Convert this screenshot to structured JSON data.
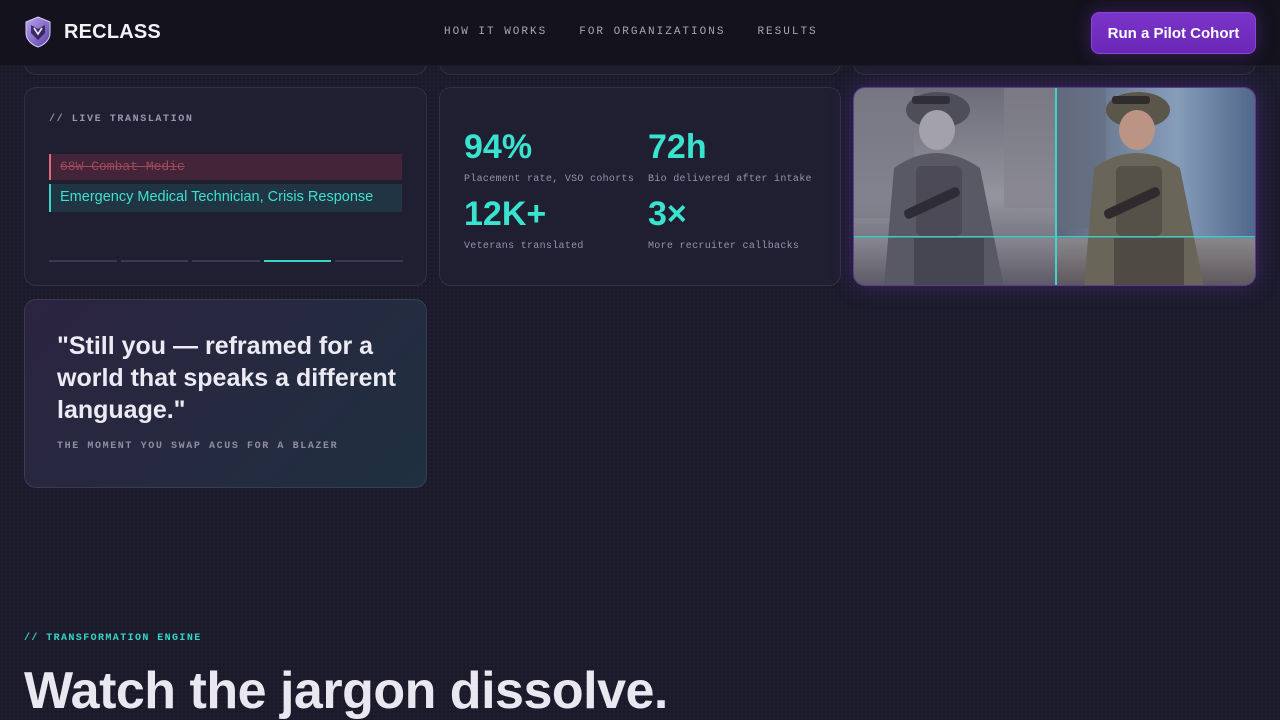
{
  "header": {
    "brand": "RECLASS",
    "nav": [
      "HOW IT WORKS",
      "FOR ORGANIZATIONS",
      "RESULTS"
    ],
    "cta": "Run a Pilot Cohort"
  },
  "live_translation": {
    "label": "// LIVE TRANSLATION",
    "original": "68W Combat Medic",
    "translated": "Emergency Medical Technician, Crisis Response",
    "progress": {
      "steps": 5,
      "active_step": 4
    }
  },
  "stats": [
    {
      "value": "94%",
      "label": "Placement rate, VSO cohorts"
    },
    {
      "value": "72h",
      "label": "Bio delivered after intake"
    },
    {
      "value": "12K+",
      "label": "Veterans translated"
    },
    {
      "value": "3×",
      "label": "More recruiter callbacks"
    }
  ],
  "quote": {
    "text": "\"Still you — reframed for a world that speaks a different language.\"",
    "caption": "THE MOMENT YOU SWAP ACUS FOR A BLAZER"
  },
  "section": {
    "eyebrow": "// TRANSFORMATION ENGINE",
    "title": "Watch the jargon dissolve."
  },
  "colors": {
    "accent_teal": "#39e3cf",
    "accent_purple": "#7b34c9",
    "background": "#1b1a2b",
    "error_red": "#e06a7c"
  }
}
